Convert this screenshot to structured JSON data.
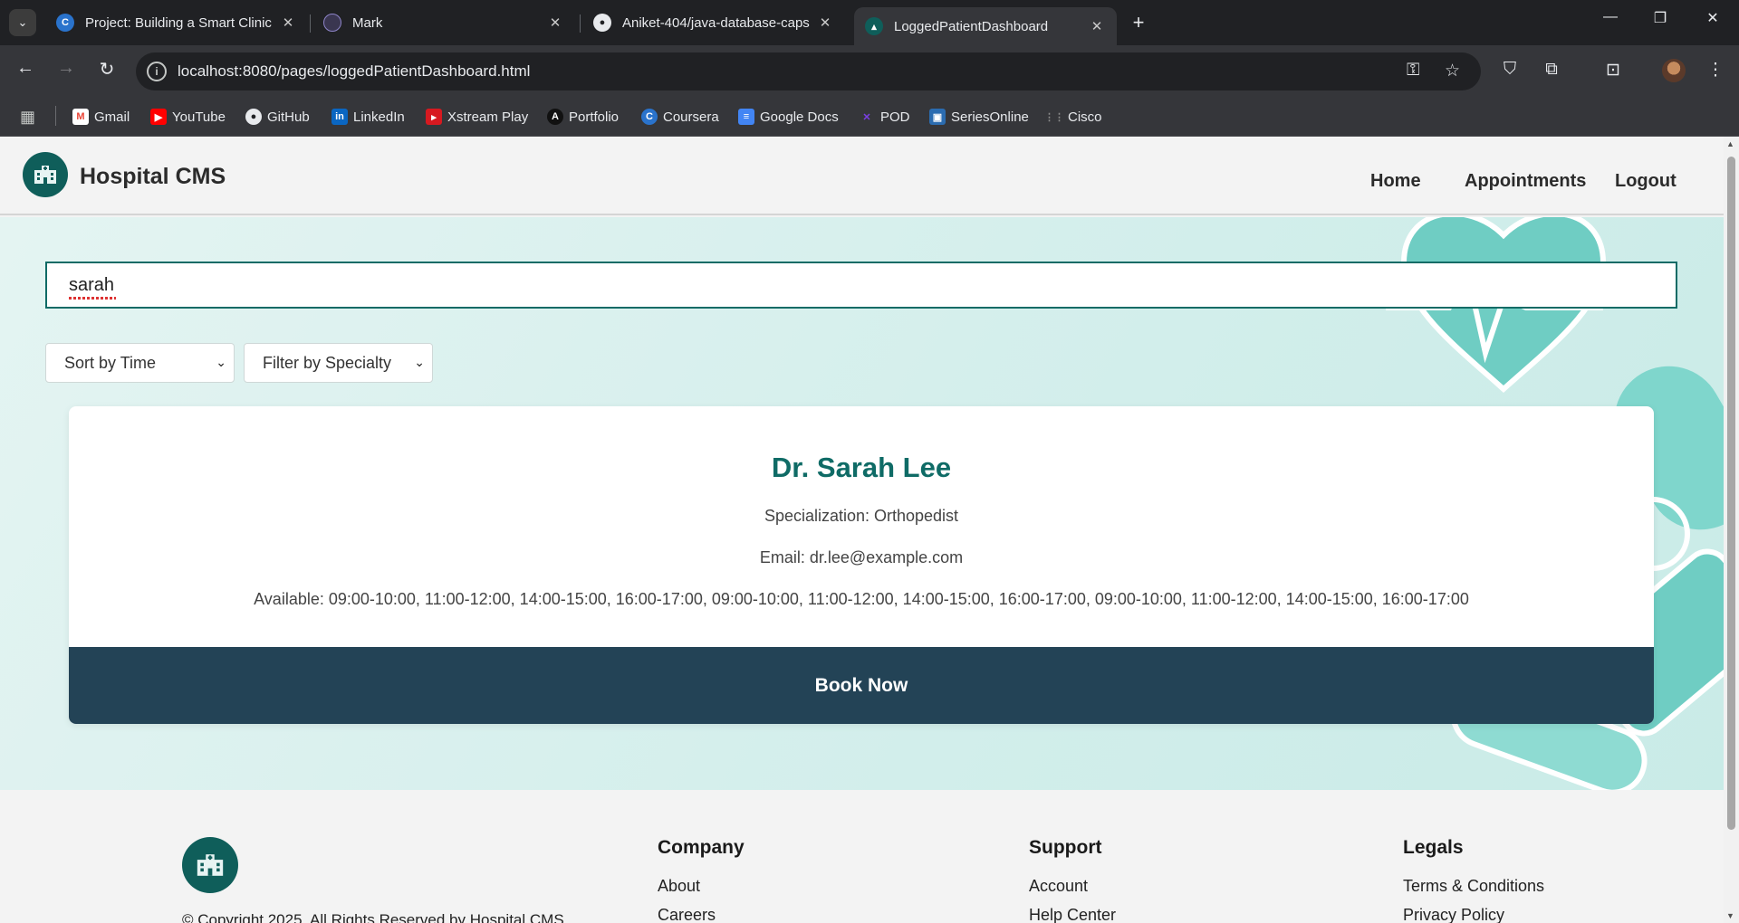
{
  "browser": {
    "tabs": [
      {
        "title": "Project: Building a Smart Clinic",
        "icon": "coursera-icon",
        "active": false
      },
      {
        "title": "Mark",
        "icon": "mark-icon",
        "active": false
      },
      {
        "title": "Aniket-404/java-database-caps",
        "icon": "github-icon",
        "active": false
      },
      {
        "title": "LoggedPatientDashboard",
        "icon": "hospital-icon",
        "active": true
      }
    ],
    "url": "localhost:8080/pages/loggedPatientDashboard.html",
    "bookmarks": [
      {
        "label": "Gmail",
        "color": "#ea4335"
      },
      {
        "label": "YouTube",
        "color": "#ff0000"
      },
      {
        "label": "GitHub",
        "color": "#e8eaed"
      },
      {
        "label": "LinkedIn",
        "color": "#0a66c2"
      },
      {
        "label": "Xstream Play",
        "color": "#d71920"
      },
      {
        "label": "Portfolio",
        "color": "#111111"
      },
      {
        "label": "Coursera",
        "color": "#2a73cc"
      },
      {
        "label": "Google Docs",
        "color": "#4285f4"
      },
      {
        "label": "POD",
        "color": "#7b3fe4"
      },
      {
        "label": "SeriesOnline",
        "color": "#2b6cb0"
      },
      {
        "label": "Cisco",
        "color": "#8a8a8a"
      }
    ]
  },
  "header": {
    "brand": "Hospital CMS",
    "nav": [
      "Home",
      "Appointments",
      "Logout"
    ]
  },
  "search": {
    "value": "sarah"
  },
  "filters": {
    "sort": "Sort by Time",
    "specialty": "Filter by Specialty"
  },
  "doctor_card": {
    "name": "Dr. Sarah Lee",
    "specialization": "Specialization: Orthopedist",
    "email": "Email: dr.lee@example.com",
    "availability": "Available: 09:00-10:00, 11:00-12:00, 14:00-15:00, 16:00-17:00, 09:00-10:00, 11:00-12:00, 14:00-15:00, 16:00-17:00, 09:00-10:00, 11:00-12:00, 14:00-15:00, 16:00-17:00",
    "book_label": "Book Now"
  },
  "footer": {
    "copyright": "© Copyright 2025. All Rights Reserved by Hospital CMS",
    "columns": [
      {
        "heading": "Company",
        "links": [
          "About",
          "Careers"
        ]
      },
      {
        "heading": "Support",
        "links": [
          "Account",
          "Help Center"
        ]
      },
      {
        "heading": "Legals",
        "links": [
          "Terms & Conditions",
          "Privacy Policy"
        ]
      }
    ]
  },
  "colors": {
    "brand_teal": "#0f6b66",
    "book_button": "#234356",
    "hero_bg": "#d2eeeb"
  }
}
